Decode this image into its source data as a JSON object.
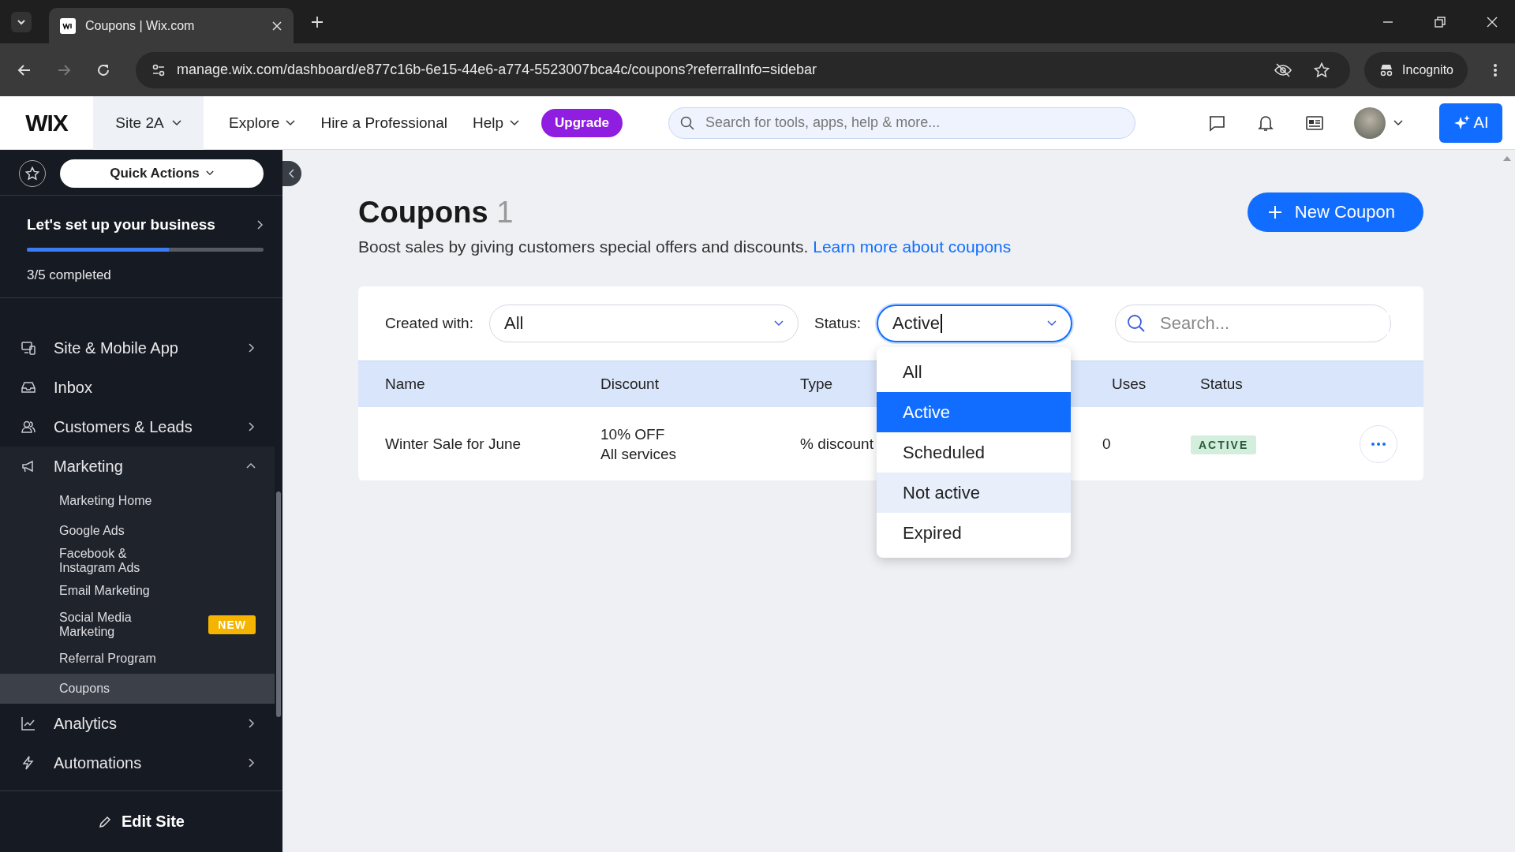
{
  "browser": {
    "tab_title": "Coupons | Wix.com",
    "url": "manage.wix.com/dashboard/e877c16b-6e15-44e6-a774-5523007bca4c/coupons?referralInfo=sidebar",
    "incognito_label": "Incognito"
  },
  "topbar": {
    "logo": "WIX",
    "site": "Site 2A",
    "nav": [
      {
        "label": "Explore",
        "dropdown": true
      },
      {
        "label": "Hire a Professional",
        "dropdown": false
      },
      {
        "label": "Help",
        "dropdown": true
      }
    ],
    "upgrade": "Upgrade",
    "search_placeholder": "Search for tools, apps, help & more...",
    "ai": "AI"
  },
  "sidebar": {
    "quick_actions": "Quick Actions",
    "setup": {
      "title": "Let's set up your business",
      "level": 0.6,
      "progress_text": "3/5 completed"
    },
    "items": [
      {
        "label": "Site & Mobile App",
        "expandable": true,
        "expanded": false
      },
      {
        "label": "Inbox",
        "expandable": false,
        "expanded": false
      },
      {
        "label": "Customers & Leads",
        "expandable": true,
        "expanded": false
      },
      {
        "label": "Marketing",
        "expandable": true,
        "expanded": true,
        "children": [
          {
            "label": "Marketing Home",
            "selected": false
          },
          {
            "label": "Google Ads",
            "selected": false
          },
          {
            "label": "Facebook & Instagram Ads",
            "selected": false
          },
          {
            "label": "Email Marketing",
            "selected": false
          },
          {
            "label": "Social Media Marketing",
            "selected": false,
            "badge": "NEW"
          },
          {
            "label": "Referral Program",
            "selected": false
          },
          {
            "label": "Coupons",
            "selected": true
          }
        ]
      },
      {
        "label": "Analytics",
        "expandable": true,
        "expanded": false
      },
      {
        "label": "Automations",
        "expandable": true,
        "expanded": false
      }
    ],
    "edit_site": "Edit Site"
  },
  "page": {
    "title": "Coupons",
    "count": "1",
    "description": "Boost sales by giving customers special offers and discounts.",
    "link": "Learn more about coupons",
    "new_button": "New Coupon"
  },
  "filters": {
    "created_label": "Created with:",
    "created_value": "All",
    "status_label": "Status:",
    "status_value": "Active",
    "search_placeholder": "Search..."
  },
  "table": {
    "columns": [
      "Name",
      "Discount",
      "Type",
      "Uses",
      "Status"
    ],
    "rows": [
      {
        "name": "Winter Sale for June",
        "discount": [
          "10% OFF",
          "All services"
        ],
        "type": "% discount",
        "uses": "0",
        "status": "ACTIVE"
      }
    ]
  },
  "dropdown": {
    "options": [
      {
        "label": "All",
        "selected": false,
        "hovered": false
      },
      {
        "label": "Active",
        "selected": true,
        "hovered": false
      },
      {
        "label": "Scheduled",
        "selected": false,
        "hovered": false
      },
      {
        "label": "Not active",
        "selected": false,
        "hovered": true
      },
      {
        "label": "Expired",
        "selected": false,
        "hovered": false
      }
    ]
  }
}
